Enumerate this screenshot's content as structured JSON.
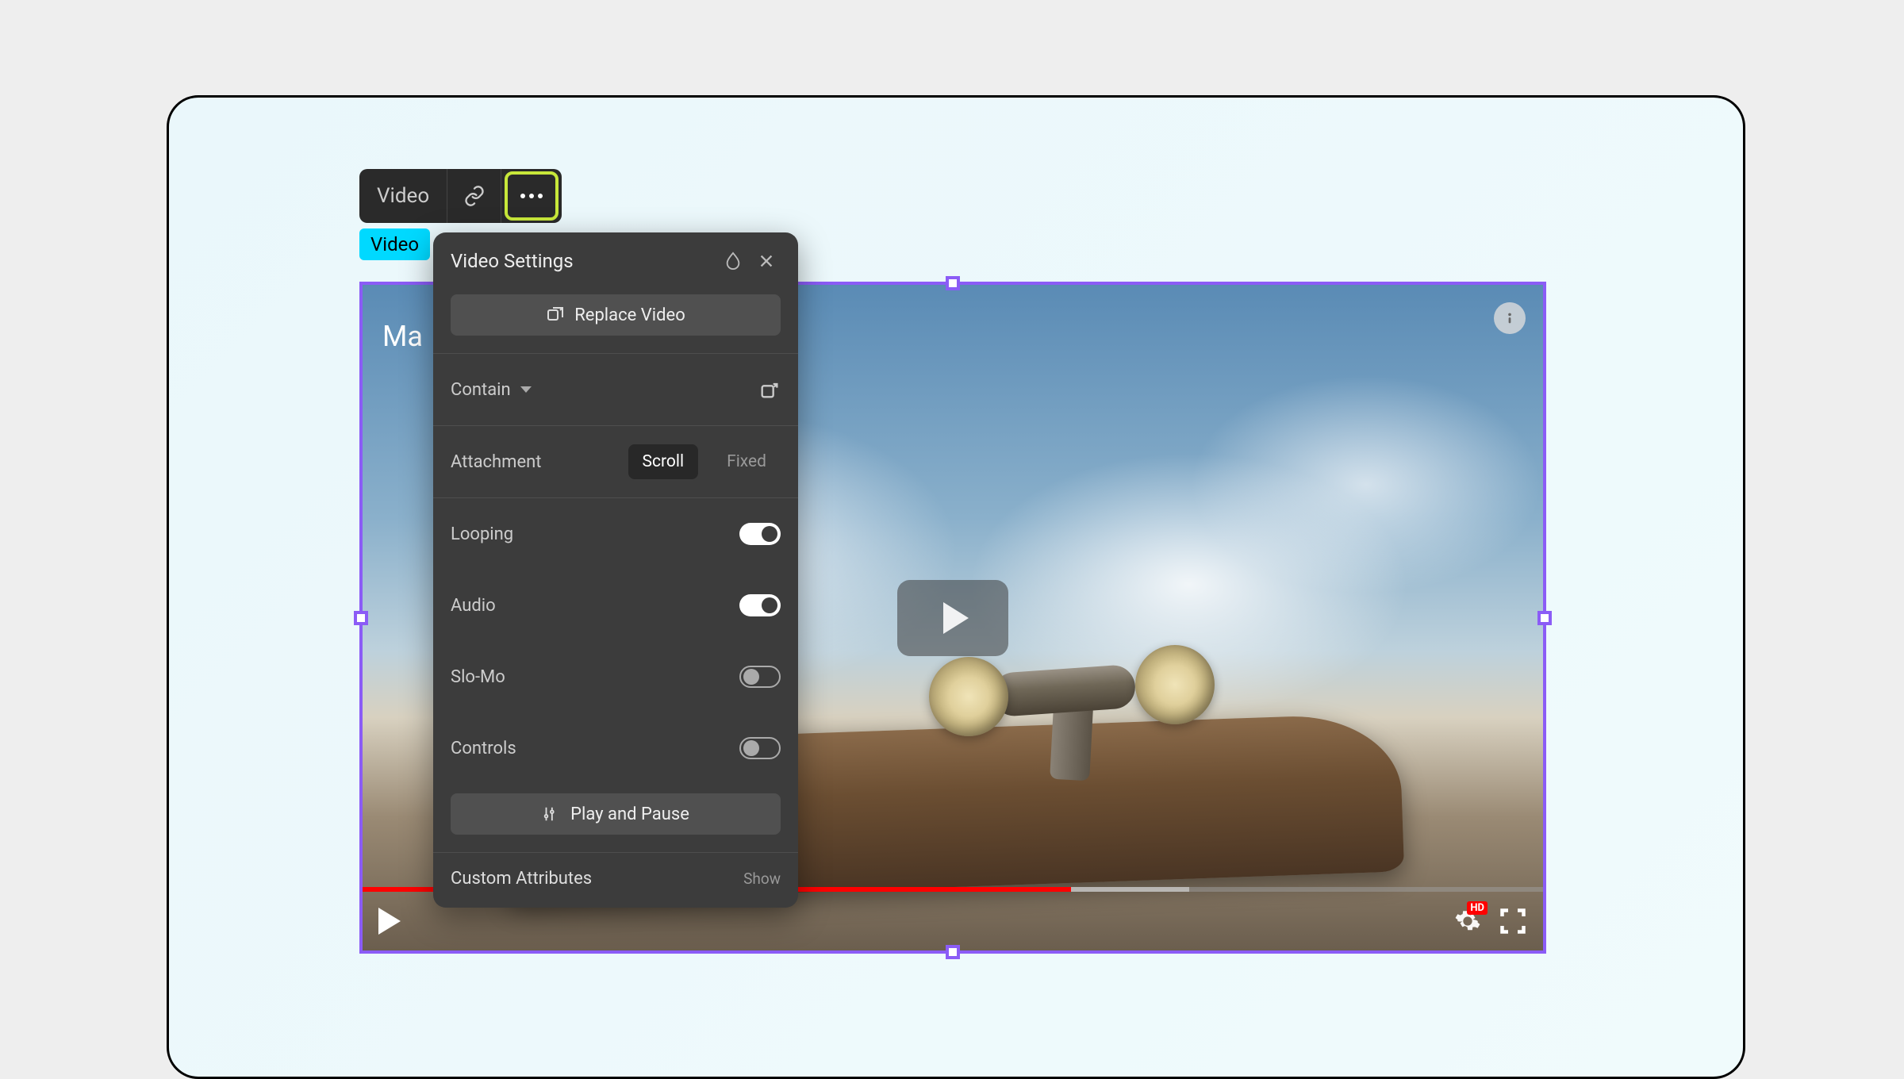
{
  "toolbar": {
    "label": "Video"
  },
  "tag": {
    "label": "Video"
  },
  "video": {
    "title_overlay": "Ma",
    "progress_percent": 60
  },
  "panel": {
    "title": "Video Settings",
    "replace_label": "Replace Video",
    "contain": {
      "label": "Contain"
    },
    "attachment": {
      "label": "Attachment",
      "options": [
        "Scroll",
        "Fixed"
      ],
      "active": "Scroll"
    },
    "toggles": {
      "looping": {
        "label": "Looping",
        "on": true
      },
      "audio": {
        "label": "Audio",
        "on": true
      },
      "slomo": {
        "label": "Slo-Mo",
        "on": false
      },
      "controls": {
        "label": "Controls",
        "on": false
      }
    },
    "playpause_label": "Play and Pause",
    "custom_attributes": {
      "label": "Custom Attributes",
      "action": "Show"
    }
  },
  "colors": {
    "highlight": "#c8e83a",
    "tag": "#00d9ff",
    "selection": "#8b5cf6",
    "progress": "#ff0000"
  }
}
